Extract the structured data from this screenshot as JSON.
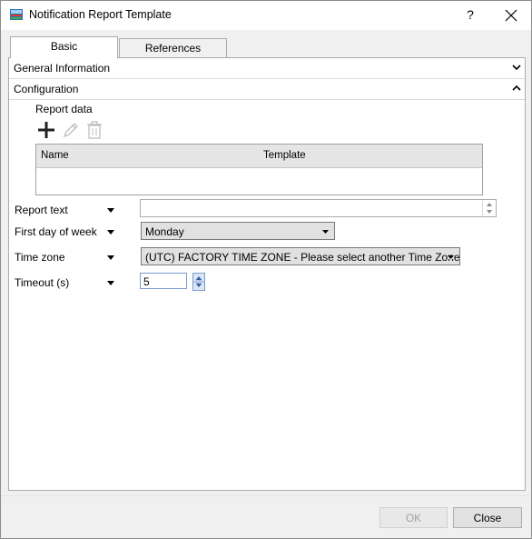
{
  "window": {
    "title": "Notification Report Template",
    "help_label": "?",
    "icon": "app-report-icon"
  },
  "tabs": [
    {
      "label": "Basic",
      "active": true
    },
    {
      "label": "References",
      "active": false
    }
  ],
  "sections": {
    "general": {
      "label": "General Information",
      "expanded": false
    },
    "configuration": {
      "label": "Configuration",
      "expanded": true
    }
  },
  "report_data": {
    "label": "Report data",
    "toolbar": [
      "add-icon",
      "edit-icon",
      "delete-icon"
    ],
    "columns": [
      "Name",
      "Template"
    ],
    "rows": []
  },
  "fields": {
    "report_text": {
      "label": "Report text",
      "value": ""
    },
    "first_day": {
      "label": "First day of week",
      "value": "Monday"
    },
    "time_zone": {
      "label": "Time zone",
      "value": "(UTC) FACTORY TIME ZONE - Please select another Time Zone!"
    },
    "timeout": {
      "label": "Timeout (s)",
      "value": "5"
    }
  },
  "buttons": {
    "ok": "OK",
    "close": "Close"
  },
  "colors": {
    "accent_blue": "#7a9ccf",
    "border": "#acacac"
  }
}
